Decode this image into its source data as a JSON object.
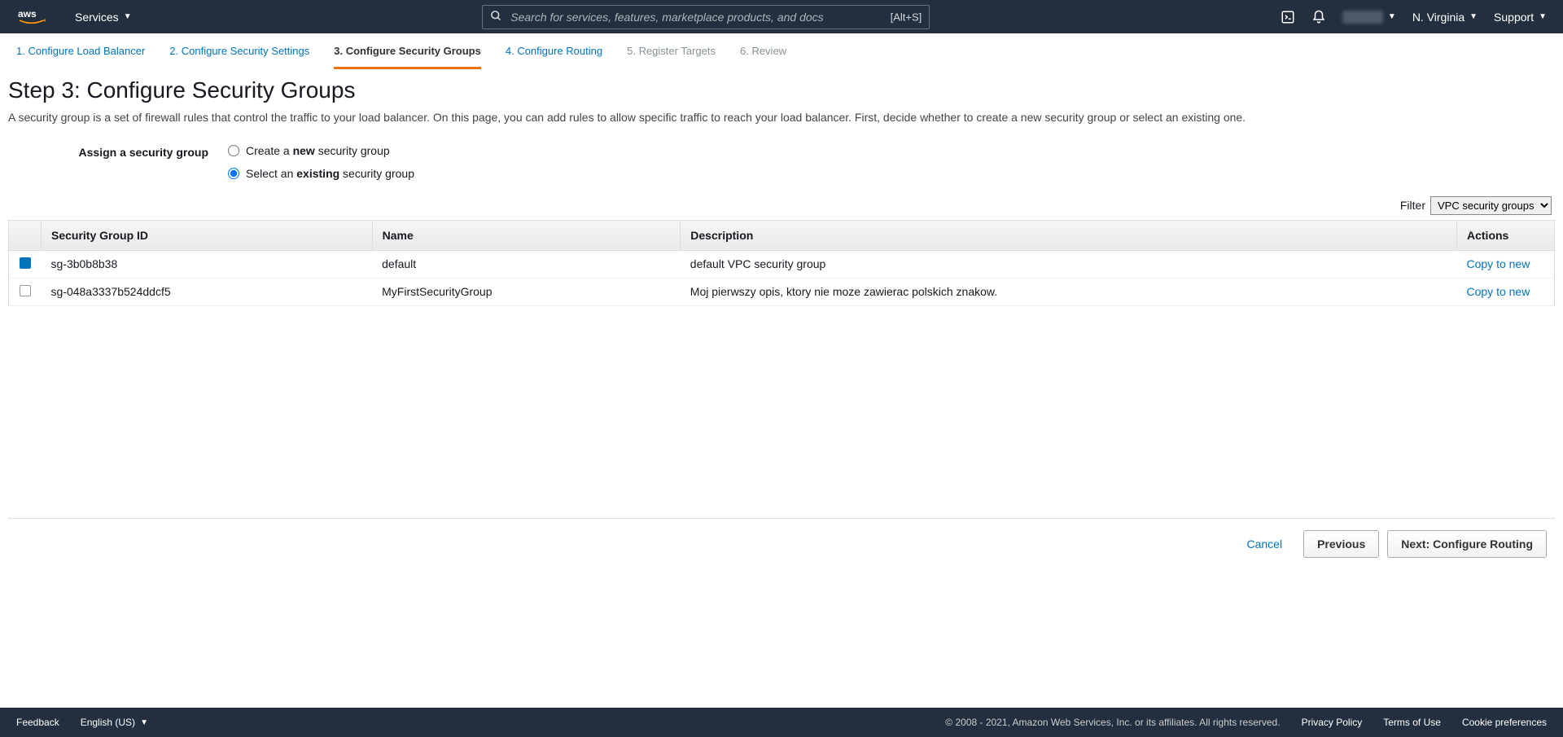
{
  "nav": {
    "services_label": "Services",
    "search_placeholder": "Search for services, features, marketplace products, and docs",
    "search_shortcut": "[Alt+S]",
    "region": "N. Virginia",
    "support": "Support"
  },
  "wizard_steps": [
    {
      "label": "1. Configure Load Balancer",
      "state": "link"
    },
    {
      "label": "2. Configure Security Settings",
      "state": "link"
    },
    {
      "label": "3. Configure Security Groups",
      "state": "active"
    },
    {
      "label": "4. Configure Routing",
      "state": "link"
    },
    {
      "label": "5. Register Targets",
      "state": "disabled"
    },
    {
      "label": "6. Review",
      "state": "disabled"
    }
  ],
  "page": {
    "heading": "Step 3: Configure Security Groups",
    "description": "A security group is a set of firewall rules that control the traffic to your load balancer. On this page, you can add rules to allow specific traffic to reach your load balancer. First, decide whether to create a new security group or select an existing one."
  },
  "form": {
    "assign_label": "Assign a security group",
    "create_text_before": "Create a ",
    "create_text_bold": "new",
    "create_text_after": " security group",
    "select_text_before": "Select an ",
    "select_text_bold": "existing",
    "select_text_after": " security group"
  },
  "filter": {
    "label": "Filter",
    "selected": "VPC security groups"
  },
  "table": {
    "headers": {
      "sgid": "Security Group ID",
      "name": "Name",
      "desc": "Description",
      "actions": "Actions"
    },
    "rows": [
      {
        "checked": true,
        "id": "sg-3b0b8b38",
        "name": "default",
        "desc": "default VPC security group",
        "action": "Copy to new"
      },
      {
        "checked": false,
        "id": "sg-048a3337b524ddcf5",
        "name": "MyFirstSecurityGroup",
        "desc": "Moj pierwszy opis, ktory nie moze zawierac polskich znakow.",
        "action": "Copy to new"
      }
    ]
  },
  "buttons": {
    "cancel": "Cancel",
    "previous": "Previous",
    "next": "Next: Configure Routing"
  },
  "footer": {
    "feedback": "Feedback",
    "language": "English (US)",
    "copyright": "© 2008 - 2021, Amazon Web Services, Inc. or its affiliates. All rights reserved.",
    "privacy": "Privacy Policy",
    "terms": "Terms of Use",
    "cookies": "Cookie preferences"
  }
}
